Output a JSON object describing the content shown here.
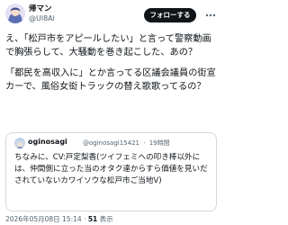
{
  "author": {
    "display_name": "帰マン",
    "handle": "@Ul8Al"
  },
  "follow_button_label": "フォローする",
  "more_icon": "more-horizontal-icon",
  "tweet": {
    "paragraphs": [
      "え、「松戸市をアピールしたい」と言って警察動画で胸張らして、大騒動を巻き起こした、あの？",
      "「都民を高収入に」とか言ってる区議会議員の街宣カーで、風俗女衒トラックの替え歌歌ってるの？"
    ]
  },
  "quoted_tweet": {
    "display_name": "oginosagi",
    "handle": "@oginosagi15421",
    "separator": "·",
    "time": "19時間",
    "text": "ちなみに、CV:戸定梨香(ツイフェミへの叩き棒以外には、仲間側に立った当のオタク達からすら価値を見いだされていないカワイソウな松戸市ご当地V)"
  },
  "footer": {
    "timestamp": "2026年05月08日 15:14",
    "separator": "·",
    "views_count": "51",
    "views_label": "表示"
  },
  "colors": {
    "text": "#0f1419",
    "secondary": "#536471",
    "border": "#cfd9de",
    "follow_bg": "#0f1419"
  }
}
